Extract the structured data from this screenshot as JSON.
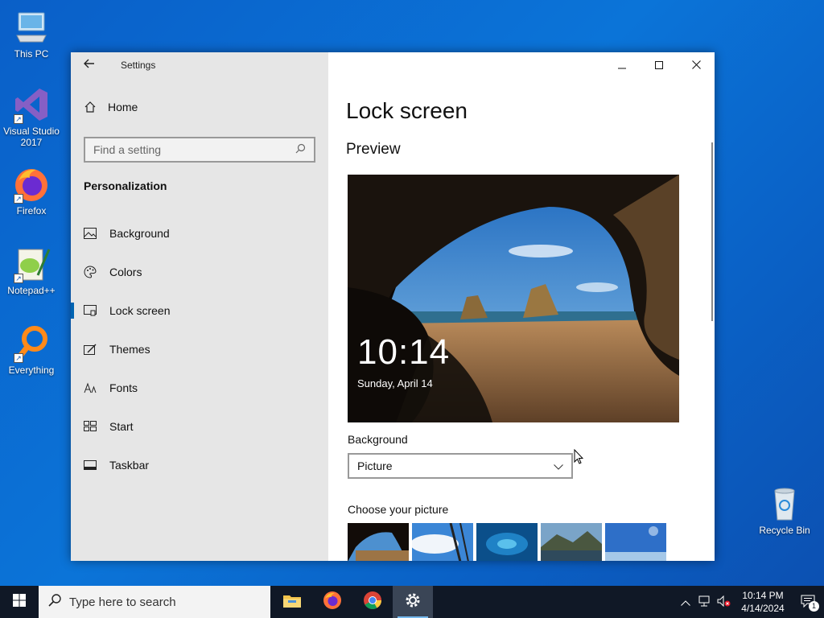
{
  "desktop": {
    "icons": [
      {
        "label": "This PC"
      },
      {
        "label": "Visual Studio 2017"
      },
      {
        "label": "Firefox"
      },
      {
        "label": "Notepad++"
      },
      {
        "label": "Everything"
      },
      {
        "label": "Recycle Bin"
      }
    ]
  },
  "window": {
    "title": "Settings",
    "back_icon": "back-arrow-icon",
    "caption": {
      "minimize": "minimize-icon",
      "maximize": "maximize-icon",
      "close": "close-icon"
    }
  },
  "sidebar": {
    "home_label": "Home",
    "search_placeholder": "Find a setting",
    "section": "Personalization",
    "items": [
      {
        "label": "Background",
        "icon": "picture-icon"
      },
      {
        "label": "Colors",
        "icon": "palette-icon"
      },
      {
        "label": "Lock screen",
        "icon": "lock-screen-icon",
        "active": true
      },
      {
        "label": "Themes",
        "icon": "themes-icon"
      },
      {
        "label": "Fonts",
        "icon": "fonts-icon"
      },
      {
        "label": "Start",
        "icon": "start-icon"
      },
      {
        "label": "Taskbar",
        "icon": "taskbar-icon"
      }
    ]
  },
  "main": {
    "title": "Lock screen",
    "preview_heading": "Preview",
    "preview_time": "10:14",
    "preview_date": "Sunday, April 14",
    "background_label": "Background",
    "background_value": "Picture",
    "choose_label": "Choose your picture"
  },
  "taskbar": {
    "search_placeholder": "Type here to search",
    "time": "10:14 PM",
    "date": "4/14/2024",
    "notification_count": "1",
    "accent": "#76b9ed"
  }
}
